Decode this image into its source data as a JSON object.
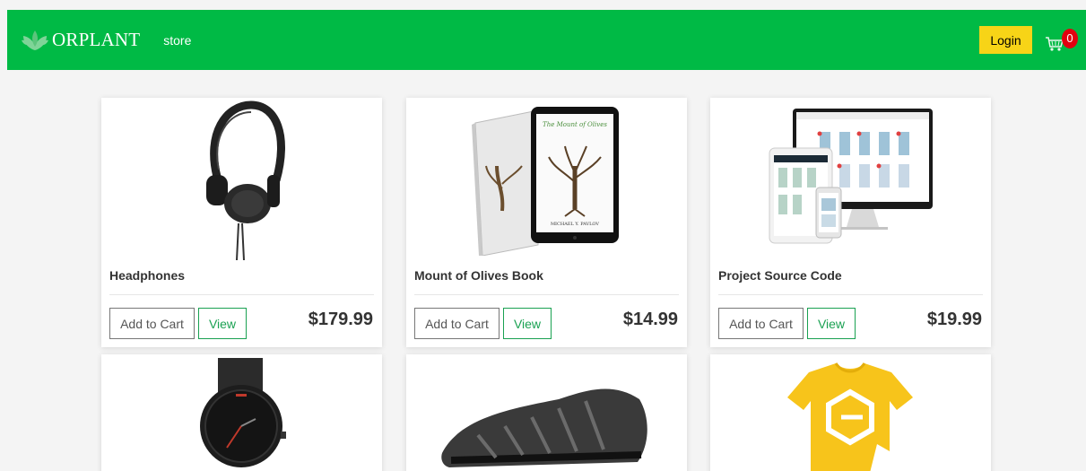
{
  "navbar": {
    "brand": "ORPLANT",
    "link_store": "store",
    "login_label": "Login",
    "cart_count": "0",
    "color": "#00ba45"
  },
  "products": [
    {
      "title": "Headphones",
      "price": "$179.99",
      "add_label": "Add to Cart",
      "view_label": "View"
    },
    {
      "title": "Mount of Olives Book",
      "price": "$14.99",
      "add_label": "Add to Cart",
      "view_label": "View"
    },
    {
      "title": "Project Source Code",
      "price": "$19.99",
      "add_label": "Add to Cart",
      "view_label": "View"
    }
  ],
  "book_cover": {
    "title": "The Mount of Olives",
    "author": "MICHAEL Y. PAVLOV"
  },
  "product_images": [
    "headphones-image",
    "book-image",
    "website-mockup-image",
    "watch-image",
    "shoe-image",
    "tshirt-image"
  ]
}
